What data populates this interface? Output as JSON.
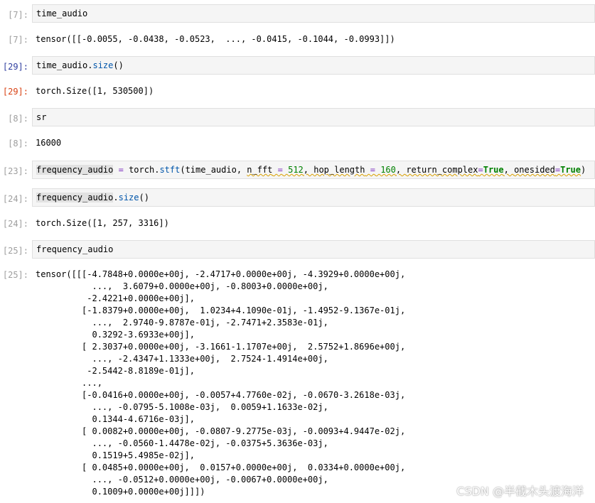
{
  "cells": [
    {
      "in_prompt": "[7]:",
      "code": "time_audio",
      "out_prompt": "[7]:",
      "output": "tensor([[-0.0055, -0.0438, -0.0523,  ..., -0.0415, -0.1044, -0.0993]])"
    },
    {
      "in_prompt": "[29]:",
      "code_obj": "time_audio",
      "code_method": "size",
      "code_parens": "()",
      "out_prompt": "[29]:",
      "output": "torch.Size([1, 530500])"
    },
    {
      "in_prompt": "[8]:",
      "code": "sr",
      "out_prompt": "[8]:",
      "output": "16000"
    },
    {
      "in_prompt": "[23]:",
      "code_var": "frequency_audio",
      "code_eq": "=",
      "code_call": "torch",
      "code_method": "stft",
      "code_arg1": "(time_audio, ",
      "code_kw1": "n_fft",
      "code_eq1": "=",
      "code_val1": "512",
      "code_kw2": "hop_length",
      "code_eq2": "=",
      "code_val2": "160",
      "code_kw3": "return_complex",
      "code_eq3": "=",
      "code_val3": "True",
      "code_kw4": "onesided",
      "code_eq4": "=",
      "code_val4": "True",
      "code_close": ")"
    },
    {
      "in_prompt": "[24]:",
      "code_obj": "frequency_audio",
      "code_method": "size",
      "code_parens": "()",
      "out_prompt": "[24]:",
      "output": "torch.Size([1, 257, 3316])"
    },
    {
      "in_prompt": "[25]:",
      "code": "frequency_audio",
      "out_prompt": "[25]:",
      "output": "tensor([[[-4.7848+0.0000e+00j, -2.4717+0.0000e+00j, -4.3929+0.0000e+00j,\n           ...,  3.6079+0.0000e+00j, -0.8003+0.0000e+00j,\n          -2.4221+0.0000e+00j],\n         [-1.8379+0.0000e+00j,  1.0234+4.1090e-01j, -1.4952-9.1367e-01j,\n           ...,  2.9740-9.8787e-01j, -2.7471+2.3583e-01j,\n           0.3292-3.6933e+00j],\n         [ 2.3037+0.0000e+00j, -3.1661-1.1707e+00j,  2.5752+1.8696e+00j,\n           ..., -2.4347+1.1333e+00j,  2.7524-1.4914e+00j,\n          -2.5442-8.8189e-01j],\n         ...,\n         [-0.0416+0.0000e+00j, -0.0057+4.7760e-02j, -0.0670-3.2618e-03j,\n           ..., -0.0795-5.1008e-03j,  0.0059+1.1633e-02j,\n           0.1344-4.6716e-03j],\n         [ 0.0082+0.0000e+00j, -0.0807-9.2775e-03j, -0.0093+4.9447e-02j,\n           ..., -0.0560-1.4478e-02j, -0.0375+5.3636e-03j,\n           0.1519+5.4985e-02j],\n         [ 0.0485+0.0000e+00j,  0.0157+0.0000e+00j,  0.0334+0.0000e+00j,\n           ..., -0.0512+0.0000e+00j, -0.0067+0.0000e+00j,\n           0.1009+0.0000e+00j]]])"
    }
  ],
  "watermark": "CSDN @半截木头渡海洋",
  "colors": {
    "in_prompt": "#303F9F",
    "out_prompt": "#D84315",
    "input_bg": "#f5f5f5",
    "keyword_green": "#008000",
    "attr_blue": "#0055aa",
    "operator_purple": "#7b2fbf"
  }
}
